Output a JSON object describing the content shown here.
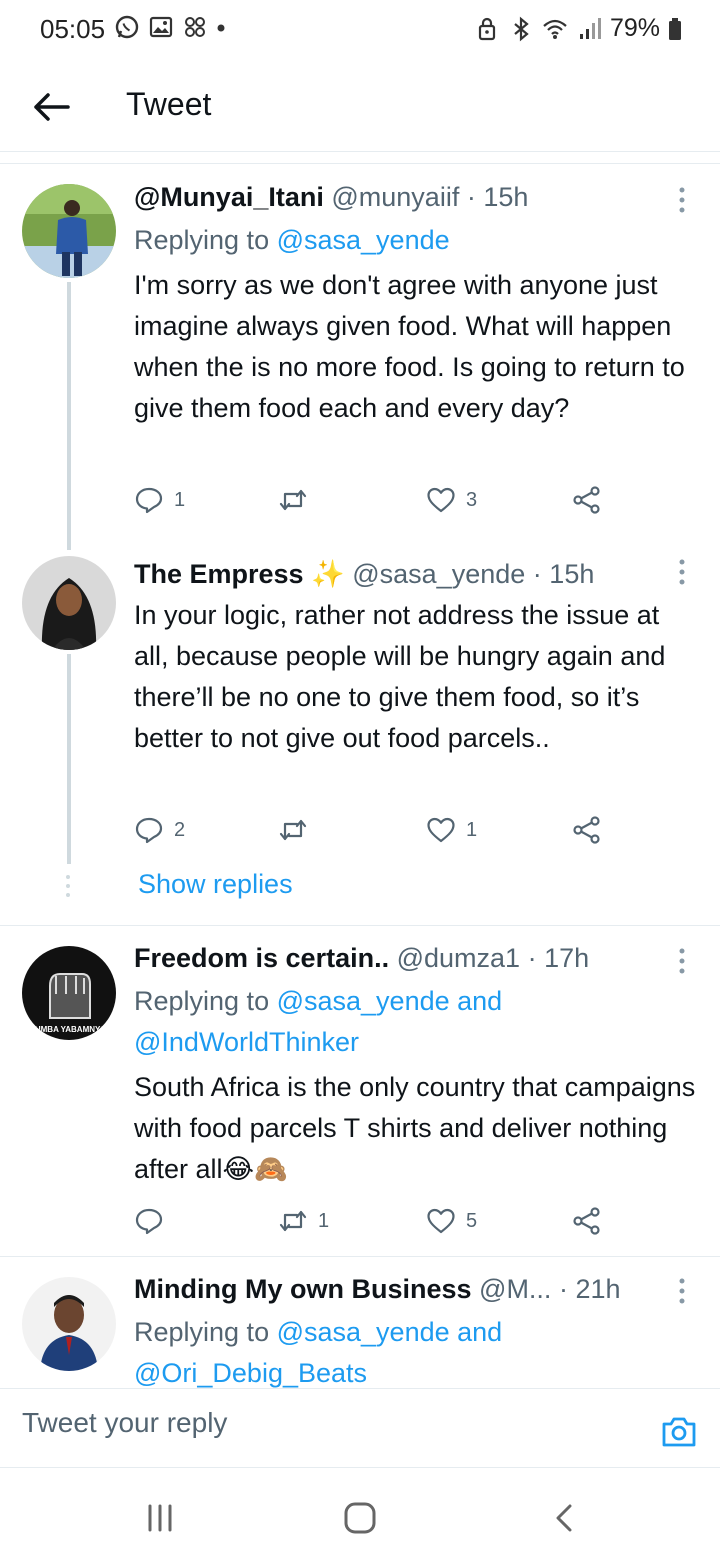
{
  "status_bar": {
    "time": "05:05",
    "battery": "79%",
    "left_icons": [
      "whatsapp-icon",
      "gallery-icon",
      "pinwheel-icon",
      "dot-icon"
    ],
    "right_icons": [
      "lock-icon",
      "bluetooth-icon",
      "wifi-icon",
      "signal-icon",
      "battery-icon"
    ]
  },
  "header": {
    "title": "Tweet",
    "back_icon": "back-arrow-icon"
  },
  "tweets": [
    {
      "name": "@Munyai_Itani",
      "handle": "@munyaiif",
      "dot": "·",
      "time": "15h",
      "replying_prefix": "Replying to ",
      "replying_to": "@sasa_yende",
      "replying_and": "",
      "replying_to_2": "",
      "text": "I'm sorry as we don't agree with anyone just imagine always given food. What will happen when the is no more food. Is going to return to give them food each and every day?",
      "replies": "1",
      "retweets": "",
      "likes": "3"
    },
    {
      "name": "The Empress",
      "emoji": "✨",
      "handle": "@sasa_yende",
      "dot": "·",
      "time": "15h",
      "text": "In your logic, rather not address the issue at all, because people will be hungry again and there’ll be no one to give them food, so it’s better to not give out food parcels..",
      "replies": "2",
      "retweets": "",
      "likes": "1"
    },
    {
      "name": "Freedom is certain..",
      "handle": "@dumza1",
      "dot": "·",
      "time": "17h",
      "replying_prefix": "Replying to ",
      "replying_to": "@sasa_yende",
      "replying_and": " and",
      "replying_to_2": "@IndWorldThinker",
      "text": "South Africa is the only country that campaigns with food parcels T shirts and deliver nothing after all😂🙈",
      "avatar_text": "IMBUMBA YABAMNYAMA",
      "replies": "",
      "retweets": "1",
      "likes": "5"
    },
    {
      "name": "Minding My own Business",
      "handle": "@M...",
      "dot": "·",
      "time": "21h",
      "replying_prefix": "Replying to ",
      "replying_to": "@sasa_yende",
      "replying_and": " and",
      "replying_to_2": "@Ori_Debig_Beats"
    }
  ],
  "show_replies": "Show replies",
  "reply_bar": {
    "placeholder": "Tweet your reply",
    "camera_icon": "camera-icon"
  },
  "nav_bar": {
    "icons": [
      "recent-apps-icon",
      "home-icon",
      "back-icon"
    ]
  },
  "colors": {
    "link": "#1d9bf0",
    "muted": "#536471",
    "divider": "#e6ecf0"
  }
}
